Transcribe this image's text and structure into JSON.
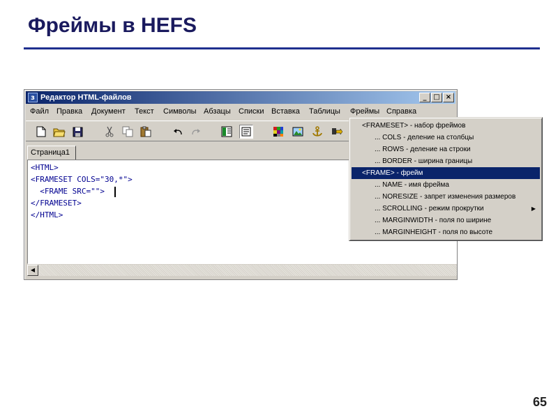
{
  "slide": {
    "title": "Фреймы в HEFS",
    "page_number": "65"
  },
  "window": {
    "title": "Редактор HTML-файлов",
    "app_icon_glyph": "з",
    "controls": {
      "minimize": "_",
      "maximize": "□",
      "close": "×"
    }
  },
  "menubar": [
    "Файл",
    "Правка",
    "Документ",
    "Текст",
    "Символы",
    "Абзацы",
    "Списки",
    "Вставка",
    "Таблицы",
    "Фреймы",
    "Справка"
  ],
  "toolbar": {
    "buttons": [
      "new-file-icon",
      "open-folder-icon",
      "save-disk-icon",
      "cut-scissors-icon",
      "copy-icon",
      "paste-icon",
      "undo-icon",
      "redo-icon",
      "split-view-icon",
      "text-view-icon",
      "color-palette-icon",
      "image-icon",
      "anchor-icon",
      "link-icon"
    ]
  },
  "tab": {
    "label": "Страница1"
  },
  "editor": {
    "lines": [
      "<HTML>",
      "<FRAMESET COLS=\"30,*\">",
      "  <FRAME SRC=\"\">",
      "</FRAMESET>",
      "</HTML>"
    ]
  },
  "popup_menu": {
    "items": [
      {
        "label": "<FRAMESET> - набор фреймов",
        "indent": false,
        "selected": false,
        "submenu": false
      },
      {
        "label": "... COLS - деление на столбцы",
        "indent": true,
        "selected": false,
        "submenu": false
      },
      {
        "label": "... ROWS - деление на строки",
        "indent": true,
        "selected": false,
        "submenu": false
      },
      {
        "label": "... BORDER - ширина границы",
        "indent": true,
        "selected": false,
        "submenu": false
      },
      {
        "label": "<FRAME> - фрейм",
        "indent": false,
        "selected": true,
        "submenu": false
      },
      {
        "label": "... NAME - имя фрейма",
        "indent": true,
        "selected": false,
        "submenu": false
      },
      {
        "label": "... NORESIZE - запрет изменения размеров",
        "indent": true,
        "selected": false,
        "submenu": false
      },
      {
        "label": "... SCROLLING - режим прокрутки",
        "indent": true,
        "selected": false,
        "submenu": true
      },
      {
        "label": "... MARGINWIDTH - поля по ширине",
        "indent": true,
        "selected": false,
        "submenu": false
      },
      {
        "label": "... MARGINHEIGHT - поля по высоте",
        "indent": true,
        "selected": false,
        "submenu": false
      }
    ],
    "submenu_arrow": "▶"
  },
  "colors": {
    "title_text": "#1a1a5e",
    "title_rule": "#1f2f8f",
    "titlebar_start": "#0a246a",
    "titlebar_end": "#a6caf0",
    "code_text": "#000090",
    "menu_selected": "#0a246a"
  }
}
